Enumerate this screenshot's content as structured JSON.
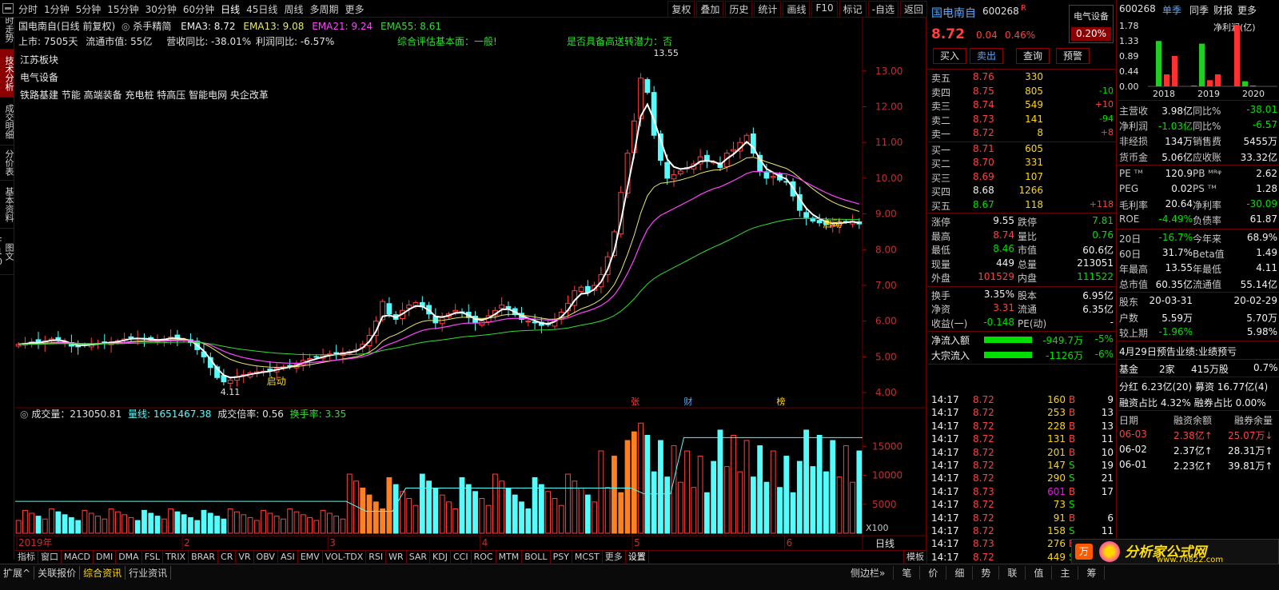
{
  "toolbar": {
    "periods": [
      "分时",
      "1分钟",
      "5分钟",
      "15分钟",
      "30分钟",
      "60分钟",
      "日线",
      "45日线",
      "周线",
      "多周期",
      "更多"
    ],
    "tools": [
      "复权",
      "叠加",
      "历史",
      "统计",
      "画线",
      "F10",
      "标记",
      "-自选",
      "返回"
    ]
  },
  "left_tabs": [
    "分时走势",
    "技术分析",
    "成交明细",
    "分价表",
    "基本资料",
    "图文F10"
  ],
  "chart": {
    "title": "国电南自(日线 前复权)",
    "strategy": "杀手精简",
    "ema3": "EMA3: 8.72",
    "ema13": "EMA13: 9.08",
    "ema21": "EMA21: 9.24",
    "ema55": "EMA55: 8.61",
    "listed": "上市: 7505天",
    "float_cap": "流通市值: 55亿",
    "rev_yoy": "营收同比: -38.01%",
    "profit_yoy": "利润同比: -6.57%",
    "assessment": "综合评估基本面：一般!",
    "high_transfer": "是否具备高送转潜力：否",
    "board1": "江苏板块",
    "board2": "电气设备",
    "concepts": "铁路基建 节能 高端装备 充电桩 特高压 智能电网 央企改革",
    "max_label": "13.55",
    "min_label": "4.11",
    "start_label1": "启动",
    "start_label2": "启动",
    "event_labels": [
      "张",
      "财",
      "榜"
    ],
    "volume_line": "成交量：213050.81",
    "vol_ma": "量线: 1651467.38",
    "vol_ratio": "成交倍率: 0.56",
    "turnover": "换手率: 3.35",
    "x100": "X100",
    "period_label": "日线",
    "months": [
      "2019年",
      "2",
      "3",
      "4",
      "5",
      "6"
    ]
  },
  "chart_data": {
    "type": "candlestick",
    "price_axis": [
      "13.00",
      "12.00",
      "11.00",
      "10.00",
      "9.00",
      "8.00",
      "7.00",
      "6.00",
      "5.00",
      "4.00"
    ],
    "volume_axis": [
      "15000",
      "10000",
      "5000"
    ],
    "closes": [
      5.35,
      5.38,
      5.42,
      5.4,
      5.45,
      5.5,
      5.47,
      5.42,
      5.3,
      5.28,
      5.32,
      5.36,
      5.38,
      5.4,
      5.42,
      5.45,
      5.5,
      5.55,
      5.52,
      5.5,
      5.48,
      5.45,
      5.5,
      5.55,
      5.52,
      5.48,
      5.4,
      5.2,
      5.0,
      4.7,
      4.42,
      4.3,
      4.35,
      4.45,
      4.5,
      4.55,
      4.58,
      4.6,
      4.62,
      4.68,
      4.72,
      4.75,
      4.8,
      4.9,
      4.95,
      5.0,
      5.05,
      5.08,
      5.1,
      5.12,
      5.15,
      5.2,
      5.35,
      5.6,
      6.0,
      6.55,
      6.2,
      6.05,
      6.3,
      6.45,
      6.52,
      6.4,
      6.2,
      5.95,
      6.1,
      6.2,
      6.3,
      6.25,
      6.1,
      5.95,
      6.0,
      6.15,
      6.3,
      6.45,
      6.35,
      6.18,
      6.05,
      6.0,
      5.95,
      5.88,
      5.9,
      6.05,
      6.25,
      6.5,
      6.85,
      6.95,
      6.8,
      7.0,
      7.3,
      7.8,
      8.5,
      9.6,
      10.7,
      11.6,
      12.8,
      12.4,
      11.2,
      10.5,
      10.0,
      10.1,
      10.2,
      10.3,
      10.4,
      10.6,
      10.5,
      10.45,
      10.3,
      10.7,
      10.8,
      11.0,
      11.2,
      10.7,
      10.2,
      10.0,
      10.05,
      9.95,
      9.9,
      9.5,
      9.1,
      8.9,
      8.8,
      8.75,
      8.7,
      8.68,
      8.75,
      8.78,
      8.8,
      8.72
    ],
    "ema_colors": {
      "ema3": "#ffffff",
      "ema13": "#e8e870",
      "ema21": "#ff44ff",
      "ema55": "#33dd33"
    },
    "up_color": "#ff4040",
    "down_color": "#54fcfc",
    "vol_ma_level": 16500
  },
  "quote": {
    "name": "国电南自",
    "code": "600268",
    "r": "R",
    "sector": "电气设备",
    "price": "8.72",
    "change": "0.04",
    "pct": "0.46%",
    "sector_pct": "0.20%",
    "buy_btn": "买入",
    "sell_btn": "卖出",
    "query_btn": "查询",
    "alert_btn": "预警",
    "asks": [
      {
        "label": "卖五",
        "price": "8.76",
        "vol": "330",
        "chg": ""
      },
      {
        "label": "卖四",
        "price": "8.75",
        "vol": "805",
        "chg": "-10"
      },
      {
        "label": "卖三",
        "price": "8.74",
        "vol": "549",
        "chg": "+10"
      },
      {
        "label": "卖二",
        "price": "8.73",
        "vol": "141",
        "chg": "-94"
      },
      {
        "label": "卖一",
        "price": "8.72",
        "vol": "8",
        "chg": "+8"
      }
    ],
    "bids": [
      {
        "label": "买一",
        "price": "8.71",
        "vol": "605",
        "chg": ""
      },
      {
        "label": "买二",
        "price": "8.70",
        "vol": "331",
        "chg": ""
      },
      {
        "label": "买三",
        "price": "8.69",
        "vol": "107",
        "chg": ""
      },
      {
        "label": "买四",
        "price": "8.68",
        "vol": "1266",
        "chg": ""
      },
      {
        "label": "买五",
        "price": "8.67",
        "vol": "118",
        "chg": "+118"
      }
    ],
    "stats": [
      [
        "涨停",
        "9.55",
        "跌停",
        "7.81"
      ],
      [
        "最高",
        "8.74",
        "量比",
        "0.76"
      ],
      [
        "最低",
        "8.46",
        "市值",
        "60.6亿"
      ],
      [
        "现量",
        "449",
        "总量",
        "213051"
      ],
      [
        "外盘",
        "101529",
        "内盘",
        "111522"
      ]
    ],
    "stats2": [
      [
        "换手",
        "3.35%",
        "股本",
        "6.95亿"
      ],
      [
        "净资",
        "3.31",
        "流通",
        "6.35亿"
      ],
      [
        "收益(一)",
        "-0.148",
        "PE(动)",
        "-"
      ]
    ],
    "flows": [
      {
        "label": "净流入额",
        "value": "-949.7万",
        "pct": "-5%"
      },
      {
        "label": "大宗流入",
        "value": "-1126万",
        "pct": "-6%"
      }
    ],
    "ticks": [
      [
        "14:17",
        "8.72",
        "160",
        "B",
        "9"
      ],
      [
        "14:17",
        "8.72",
        "253",
        "B",
        "13"
      ],
      [
        "14:17",
        "8.72",
        "228",
        "B",
        "13"
      ],
      [
        "14:17",
        "8.72",
        "131",
        "B",
        "11"
      ],
      [
        "14:17",
        "8.72",
        "201",
        "B",
        "10"
      ],
      [
        "14:17",
        "8.72",
        "147",
        "S",
        "19"
      ],
      [
        "14:17",
        "8.72",
        "290",
        "S",
        "21"
      ],
      [
        "14:17",
        "8.73",
        "601",
        "B",
        "17"
      ],
      [
        "14:17",
        "8.72",
        "73",
        "S",
        ""
      ],
      [
        "14:17",
        "8.72",
        "91",
        "B",
        "6"
      ],
      [
        "14:17",
        "8.72",
        "158",
        "S",
        "11"
      ],
      [
        "14:17",
        "8.73",
        "276",
        "B",
        "8"
      ],
      [
        "14:17",
        "8.72",
        "449",
        "S",
        "22"
      ]
    ]
  },
  "fin": {
    "code": "600268",
    "tabs": [
      "单季",
      "同季",
      "财报",
      "更多"
    ],
    "chart_title": "净利润(亿)",
    "y_axis": [
      "1.78",
      "1.33",
      "0.89",
      "0.44",
      "0.00"
    ],
    "years": [
      "2018",
      "2019",
      "2020"
    ],
    "bars": [
      {
        "v": 1.33,
        "c": "#22cc22"
      },
      {
        "v": 0.35,
        "c": "#ff3030"
      },
      {
        "v": 0.89,
        "c": "#ff3030"
      },
      {
        "v": 0.0,
        "c": "#22cc22"
      },
      {
        "v": 1.25,
        "c": "#22cc22"
      },
      {
        "v": 0.18,
        "c": "#ff3030"
      },
      {
        "v": 0.35,
        "c": "#ff3030"
      },
      {
        "v": 1.78,
        "c": "#ff3030"
      },
      {
        "v": 0.15,
        "c": "#22cc22"
      },
      {
        "v": 0.0,
        "c": "#22cc22"
      }
    ],
    "rows": [
      [
        "主营收",
        "3.98亿",
        "同比%",
        "-38.01"
      ],
      [
        "净利润",
        "-1.03亿",
        "同比%",
        "-6.57"
      ],
      [
        "非经损",
        "134万",
        "销售费",
        "5455万"
      ],
      [
        "货币金",
        "5.06亿",
        "应收账",
        "33.32亿"
      ],
      [
        "PE ᵀᴹ",
        "120.9",
        "PB ᴹᴿᵠ",
        "2.62"
      ],
      [
        "PEG",
        "0.02",
        "PS ᵀᴹ",
        "1.28"
      ],
      [
        "毛利率",
        "20.64",
        "净利率",
        "-30.09"
      ],
      [
        "ROE",
        "-4.49%",
        "负债率",
        "61.87"
      ],
      [
        "20日",
        "-16.7%",
        "今年来",
        "68.9%"
      ],
      [
        "60日",
        "31.7%",
        "Beta值",
        "1.49"
      ],
      [
        "年最高",
        "13.55",
        "年最低",
        "4.11"
      ],
      [
        "总市值",
        "60.35亿",
        "流通值",
        "55.14亿"
      ],
      [
        "股东",
        "20-03-31",
        "",
        "20-02-29"
      ],
      [
        "户数",
        "5.59万",
        "",
        "5.70万"
      ],
      [
        "较上期",
        "-1.96%",
        "",
        "5.98%"
      ]
    ],
    "notice": "4月29日预告业绩:业绩预亏",
    "fund": [
      "基金",
      "2家",
      "415万股",
      "0.7%"
    ],
    "dividend": "分红 6.23亿(20) 募资 16.77亿(4)",
    "margin": "融资占比 4.32% 融券占比 0.00%",
    "margin_header": [
      "日期",
      "融资余额",
      "融券余量"
    ],
    "margin_rows": [
      [
        "06-03",
        "2.38亿↑",
        "25.07万↓"
      ],
      [
        "06-02",
        "2.37亿↑",
        "28.31万↑"
      ],
      [
        "06-01",
        "2.23亿↑",
        "39.81万↑"
      ]
    ]
  },
  "bottom_tabs": [
    "指标",
    "窗口",
    "MACD",
    "DMI",
    "DMA",
    "FSL",
    "TRIX",
    "BRAR",
    "CR",
    "VR",
    "OBV",
    "ASI",
    "EMV",
    "VOL-TDX",
    "RSI",
    "WR",
    "SAR",
    "KDJ",
    "CCI",
    "ROC",
    "MTM",
    "BOLL",
    "PSY",
    "MCST",
    "更多",
    "设置"
  ],
  "status_tabs": [
    "扩展^",
    "关联报价",
    "综合资讯",
    "行业资讯"
  ],
  "status_right": [
    "模板",
    "侧边栏»",
    "笔",
    "价",
    "细",
    "势",
    "联",
    "值",
    "主",
    "筹"
  ]
}
